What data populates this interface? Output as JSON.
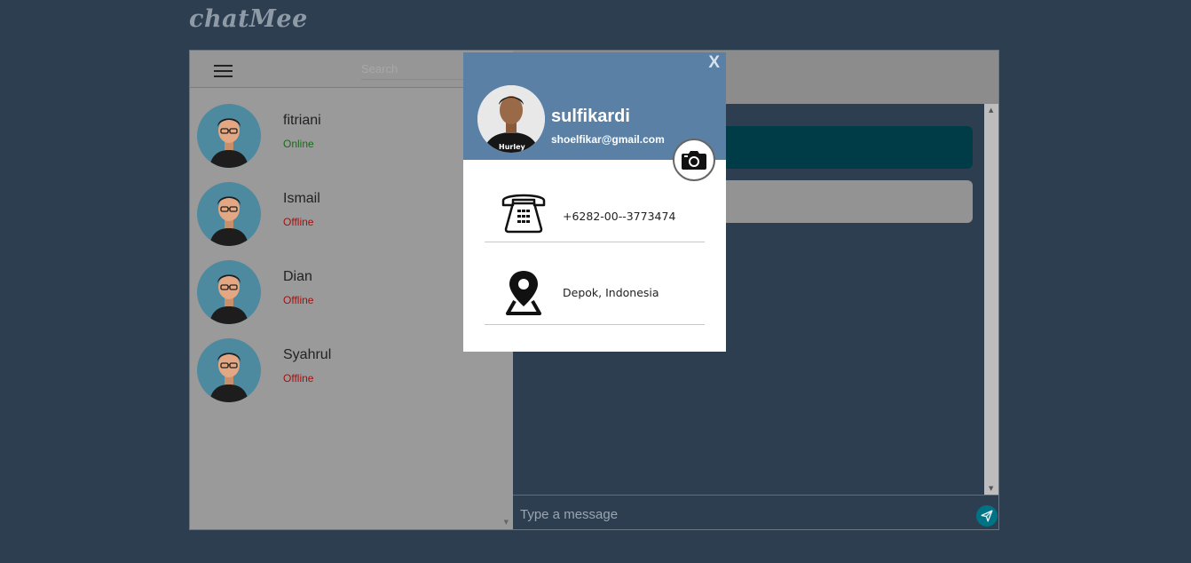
{
  "app": {
    "logo": "chatMee"
  },
  "sidebar": {
    "search_placeholder": "Search",
    "contacts": [
      {
        "name": "fitriani",
        "status": "Online"
      },
      {
        "name": "Ismail",
        "status": "Offline"
      },
      {
        "name": "Dian",
        "status": "Offline"
      },
      {
        "name": "Syahrul",
        "status": "Offline"
      }
    ]
  },
  "chat": {
    "message_placeholder": "Type a message"
  },
  "profile": {
    "close_label": "X",
    "name": "sulfikardi",
    "email": "shoelfikar@gmail.com",
    "phone": "+6282-00--3773474",
    "location": "Depok, Indonesia",
    "shirt_text": "Hurley"
  },
  "colors": {
    "background": "#2d3e50",
    "modal_header": "#5a80a5",
    "online": "#1a6b1a",
    "offline": "#a51010",
    "accent": "#007385"
  }
}
